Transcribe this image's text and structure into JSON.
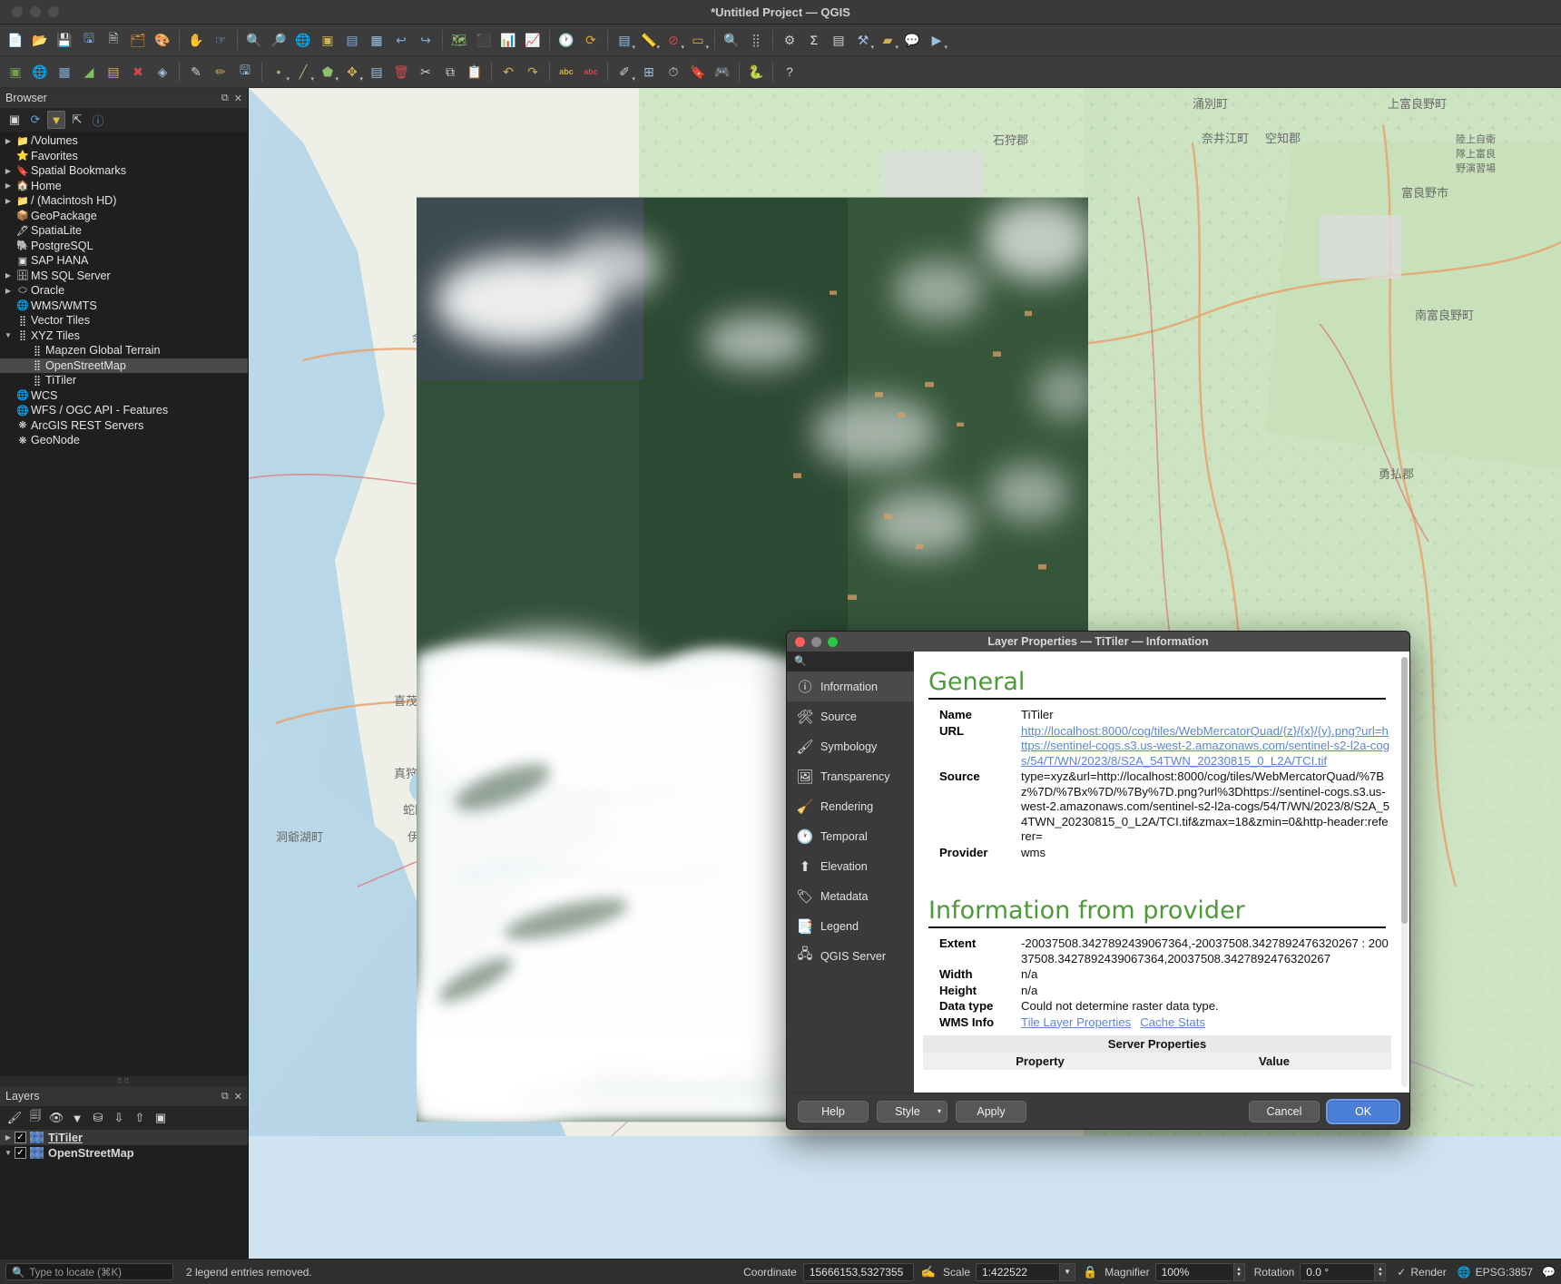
{
  "window": {
    "title": "*Untitled Project — QGIS"
  },
  "toolbar_rows": [
    [
      {
        "name": "new-project",
        "glyph": "📄",
        "color": "#e8e8e8"
      },
      {
        "name": "open-project",
        "glyph": "📂",
        "color": "#e0b152"
      },
      {
        "name": "save-project",
        "glyph": "💾",
        "color": "#7fa9d8"
      },
      {
        "name": "save-project-as",
        "glyph": "🖫",
        "color": "#7fa9d8"
      },
      {
        "name": "new-print-layout",
        "glyph": "🗎",
        "color": "#cfcfcf"
      },
      {
        "name": "layout-manager",
        "glyph": "🗂",
        "color": "#d08c3a"
      },
      {
        "name": "style-manager",
        "glyph": "🎨",
        "color": "#d04b4b"
      },
      {
        "sep": true
      },
      {
        "name": "pan-map",
        "glyph": "✋",
        "color": "#e8e8e8"
      },
      {
        "name": "pan-to-selection",
        "glyph": "☞",
        "color": "#7fa9d8"
      },
      {
        "sep": true
      },
      {
        "name": "zoom-in",
        "glyph": "🔍",
        "color": "#7fa9d8"
      },
      {
        "name": "zoom-out",
        "glyph": "🔎",
        "color": "#7fa9d8"
      },
      {
        "name": "zoom-full",
        "glyph": "🌐",
        "color": "#8fbf6f"
      },
      {
        "name": "zoom-to-selection",
        "glyph": "▣",
        "color": "#d0b050"
      },
      {
        "name": "zoom-to-layer",
        "glyph": "▤",
        "color": "#7fa9d8"
      },
      {
        "name": "zoom-to-native",
        "glyph": "▦",
        "color": "#9ac0e0"
      },
      {
        "name": "zoom-last",
        "glyph": "↩",
        "color": "#7fa9d8"
      },
      {
        "name": "zoom-next",
        "glyph": "↪",
        "color": "#7fa9d8"
      },
      {
        "sep": true
      },
      {
        "name": "new-map-view",
        "glyph": "🗺",
        "color": "#8fbf6f"
      },
      {
        "name": "new-3d-map-view",
        "glyph": "⬛",
        "color": "#9ac0e0"
      },
      {
        "name": "show-map-tips",
        "glyph": "📊",
        "color": "#d0b050"
      },
      {
        "name": "statistical-summary",
        "glyph": "📈",
        "color": "#cfcfcf"
      },
      {
        "sep": true
      },
      {
        "name": "identify-features",
        "glyph": "🕐",
        "color": "#e8e8e8"
      },
      {
        "name": "refresh",
        "glyph": "⟳",
        "color": "#e0a040"
      },
      {
        "sep": true
      },
      {
        "name": "open-attribute-table",
        "glyph": "▤",
        "color": "#9ac0e0",
        "caret": true
      },
      {
        "name": "measure-line",
        "glyph": "📏",
        "color": "#cfcfcf",
        "caret": true
      },
      {
        "name": "deselect-features",
        "glyph": "⊘",
        "color": "#d04b4b",
        "caret": true
      },
      {
        "name": "select-features",
        "glyph": "▭",
        "color": "#d0b050",
        "caret": true
      },
      {
        "sep": true
      },
      {
        "name": "select-by-expression",
        "glyph": "🔍",
        "color": "#e0e0e0"
      },
      {
        "name": "select-by-location",
        "glyph": "⣿",
        "color": "#9a9a9a"
      },
      {
        "sep": true
      },
      {
        "name": "options",
        "glyph": "⚙",
        "color": "#c8c8c8"
      },
      {
        "name": "field-calculator",
        "glyph": "Σ",
        "color": "#e8e8e8"
      },
      {
        "name": "show-layout-manager",
        "glyph": "▤",
        "color": "#cfcfcf"
      },
      {
        "name": "processing-toolbox",
        "glyph": "⚒",
        "color": "#9ac0e0",
        "caret": true
      },
      {
        "name": "measure-area",
        "glyph": "▰",
        "color": "#d0b050",
        "caret": true
      },
      {
        "name": "map-tips",
        "glyph": "💬",
        "color": "#e0d050"
      },
      {
        "name": "python-console-run",
        "glyph": "▶",
        "color": "#9ac0e0",
        "caret": true
      }
    ],
    [
      {
        "name": "new-shapefile-layer",
        "glyph": "▣",
        "color": "#6f9f4f"
      },
      {
        "name": "add-vector-layer",
        "glyph": "🌐",
        "color": "#c07a3a"
      },
      {
        "name": "add-raster-layer",
        "glyph": "▦",
        "color": "#7fa9d8"
      },
      {
        "name": "add-mesh-layer",
        "glyph": "◢",
        "color": "#7fbf5f"
      },
      {
        "name": "add-delimited-text-layer",
        "glyph": "▤",
        "color": "#d0b050"
      },
      {
        "name": "add-postgis-layer",
        "glyph": "✖",
        "color": "#d04b4b"
      },
      {
        "name": "add-spatialite-layer",
        "glyph": "◈",
        "color": "#9ac0e0"
      },
      {
        "sep": true
      },
      {
        "name": "digitize-toggle",
        "glyph": "✎",
        "color": "#cfcfcf"
      },
      {
        "name": "current-edits",
        "glyph": "✏",
        "color": "#d0a050"
      },
      {
        "name": "save-layer-edits",
        "glyph": "🖫",
        "color": "#9ac0e0"
      },
      {
        "sep": true
      },
      {
        "name": "add-feature-point",
        "glyph": "•",
        "color": "#8fbf6f",
        "caret": true
      },
      {
        "name": "add-feature-line",
        "glyph": "╱",
        "color": "#8fbf6f",
        "caret": true
      },
      {
        "name": "add-feature-polygon",
        "glyph": "⬟",
        "color": "#8fbf6f",
        "caret": true
      },
      {
        "name": "vertex-tool",
        "glyph": "✥",
        "color": "#d0b050",
        "caret": true
      },
      {
        "name": "modify-attributes",
        "glyph": "▤",
        "color": "#9ac0e0"
      },
      {
        "name": "delete-selected",
        "glyph": "🗑",
        "color": "#d04b4b"
      },
      {
        "name": "cut-features",
        "glyph": "✂",
        "color": "#cfcfcf"
      },
      {
        "name": "copy-features",
        "glyph": "⧉",
        "color": "#cfcfcf"
      },
      {
        "name": "paste-features",
        "glyph": "📋",
        "color": "#cfcfcf"
      },
      {
        "sep": true
      },
      {
        "name": "undo",
        "glyph": "↶",
        "color": "#d0b050"
      },
      {
        "name": "redo",
        "glyph": "↷",
        "color": "#d0b050"
      },
      {
        "sep": true
      },
      {
        "name": "label-toggle",
        "glyph": "abc",
        "color": "#d0b050",
        "small": true
      },
      {
        "name": "label-highlight",
        "glyph": "abc",
        "color": "#d04b4b",
        "small": true
      },
      {
        "sep": true
      },
      {
        "name": "annotations",
        "glyph": "✐",
        "color": "#cfcfcf",
        "caret": true
      },
      {
        "name": "georeferencer",
        "glyph": "⊞",
        "color": "#9ac0e0"
      },
      {
        "name": "temporal-controller",
        "glyph": "⏱",
        "color": "#cfcfcf"
      },
      {
        "name": "show-bookmarks",
        "glyph": "🔖",
        "color": "#9ac0e0"
      },
      {
        "name": "new-3d-view",
        "glyph": "🎮",
        "color": "#8aa8c8"
      },
      {
        "sep": true
      },
      {
        "name": "python-console",
        "glyph": "🐍",
        "color": "#5a9fd8"
      },
      {
        "sep": true
      },
      {
        "name": "help-contents",
        "glyph": "?",
        "color": "#cfcfcf"
      }
    ]
  ],
  "browser": {
    "title": "Browser",
    "tools": [
      {
        "name": "add-layers-icon",
        "glyph": "▣"
      },
      {
        "name": "refresh-icon",
        "glyph": "⟳"
      },
      {
        "name": "filter-browser-icon",
        "glyph": "▼",
        "active": true
      },
      {
        "name": "collapse-all-icon",
        "glyph": "⇱"
      },
      {
        "name": "enable-properties-widget-icon",
        "glyph": "ⓘ"
      }
    ],
    "items": [
      {
        "label": "/Volumes",
        "arrow": "▶",
        "icon": "📁",
        "indent": 0
      },
      {
        "label": "Favorites",
        "arrow": "",
        "icon": "⭐",
        "indent": 0
      },
      {
        "label": "Spatial Bookmarks",
        "arrow": "▶",
        "icon": "🔖",
        "indent": 0
      },
      {
        "label": "Home",
        "arrow": "▶",
        "icon": "🏠",
        "indent": 0
      },
      {
        "label": "/ (Macintosh HD)",
        "arrow": "▶",
        "icon": "📁",
        "indent": 0
      },
      {
        "label": "GeoPackage",
        "arrow": "",
        "icon": "📦",
        "indent": 0
      },
      {
        "label": "SpatiaLite",
        "arrow": "",
        "icon": "🖋",
        "indent": 0
      },
      {
        "label": "PostgreSQL",
        "arrow": "",
        "icon": "🐘",
        "indent": 0
      },
      {
        "label": "SAP HANA",
        "arrow": "",
        "icon": "▣",
        "indent": 0
      },
      {
        "label": "MS SQL Server",
        "arrow": "▶",
        "icon": "🗄",
        "indent": 0
      },
      {
        "label": "Oracle",
        "arrow": "▶",
        "icon": "⬭",
        "indent": 0
      },
      {
        "label": "WMS/WMTS",
        "arrow": "",
        "icon": "🌐",
        "indent": 0
      },
      {
        "label": "Vector Tiles",
        "arrow": "",
        "icon": "⣿",
        "indent": 0
      },
      {
        "label": "XYZ Tiles",
        "arrow": "▼",
        "icon": "⣿",
        "indent": 0
      },
      {
        "label": "Mapzen Global Terrain",
        "arrow": "",
        "icon": "⣿",
        "indent": 1
      },
      {
        "label": "OpenStreetMap",
        "arrow": "",
        "icon": "⣿",
        "indent": 1,
        "selected": true
      },
      {
        "label": "TiTiler",
        "arrow": "",
        "icon": "⣿",
        "indent": 1
      },
      {
        "label": "WCS",
        "arrow": "",
        "icon": "🌐",
        "indent": 0
      },
      {
        "label": "WFS / OGC API - Features",
        "arrow": "",
        "icon": "🌐",
        "indent": 0
      },
      {
        "label": "ArcGIS REST Servers",
        "arrow": "",
        "icon": "❋",
        "indent": 0
      },
      {
        "label": "GeoNode",
        "arrow": "",
        "icon": "❋",
        "indent": 0
      }
    ]
  },
  "layers": {
    "title": "Layers",
    "tools": [
      {
        "name": "open-layer-styling-panel-icon",
        "glyph": "🖌"
      },
      {
        "name": "add-group-icon",
        "glyph": "🗐"
      },
      {
        "name": "manage-map-themes-icon",
        "glyph": "👁"
      },
      {
        "name": "filter-legend-icon",
        "glyph": "▼"
      },
      {
        "name": "filter-legend-by-expression-icon",
        "glyph": "⛁"
      },
      {
        "name": "expand-all-icon",
        "glyph": "⇩"
      },
      {
        "name": "collapse-all-icon",
        "glyph": "⇧"
      },
      {
        "name": "remove-layer-icon",
        "glyph": "▣"
      }
    ],
    "items": [
      {
        "label": "TiTiler",
        "checked": true,
        "arrow": "▶",
        "selected": true
      },
      {
        "label": "OpenStreetMap",
        "checked": true,
        "arrow": "▼",
        "selected": false
      }
    ]
  },
  "status": {
    "locate_placeholder": "Type to locate (⌘K)",
    "message": "2 legend entries removed.",
    "coordinate_label": "Coordinate",
    "coordinate_value": "15666153,5327355",
    "scale_label": "Scale",
    "scale_value": "1:422522",
    "magnifier_label": "Magnifier",
    "magnifier_value": "100%",
    "rotation_label": "Rotation",
    "rotation_value": "0.0 °",
    "render_label": "Render",
    "render_checked": true,
    "crs_value": "EPSG:3857"
  },
  "dialog": {
    "title": "Layer Properties — TiTiler — Information",
    "search_placeholder": "",
    "sidebar": [
      {
        "label": "Information",
        "icon": "ⓘ",
        "name": "information",
        "active": true
      },
      {
        "label": "Source",
        "icon": "🛠",
        "name": "source",
        "active": false
      },
      {
        "label": "Symbology",
        "icon": "🖌",
        "name": "symbology",
        "active": false
      },
      {
        "label": "Transparency",
        "icon": "🖼",
        "name": "transparency",
        "active": false
      },
      {
        "label": "Rendering",
        "icon": "🧹",
        "name": "rendering",
        "active": false
      },
      {
        "label": "Temporal",
        "icon": "🕐",
        "name": "temporal",
        "active": false
      },
      {
        "label": "Elevation",
        "icon": "⬆",
        "name": "elevation",
        "active": false
      },
      {
        "label": "Metadata",
        "icon": "🏷",
        "name": "metadata",
        "active": false
      },
      {
        "label": "Legend",
        "icon": "📑",
        "name": "legend",
        "active": false
      },
      {
        "label": "QGIS Server",
        "icon": "🖧",
        "name": "qgis-server",
        "active": false
      }
    ],
    "general": {
      "heading": "General",
      "name_label": "Name",
      "name_value": "TiTiler",
      "url_label": "URL",
      "url_value": "http://localhost:8000/cog/tiles/WebMercatorQuad/{z}/{x}/{y}.png?url=https://sentinel-cogs.s3.us-west-2.amazonaws.com/sentinel-s2-l2a-cogs/54/T/WN/2023/8/S2A_54TWN_20230815_0_L2A/TCI.tif",
      "source_label": "Source",
      "source_value": "type=xyz&url=http://localhost:8000/cog/tiles/WebMercatorQuad/%7Bz%7D/%7Bx%7D/%7By%7D.png?url%3Dhttps://sentinel-cogs.s3.us-west-2.amazonaws.com/sentinel-s2-l2a-cogs/54/T/WN/2023/8/S2A_54TWN_20230815_0_L2A/TCI.tif&zmax=18&zmin=0&http-header:referer=",
      "provider_label": "Provider",
      "provider_value": "wms"
    },
    "provider_info": {
      "heading": "Information from provider",
      "extent_label": "Extent",
      "extent_value": "-20037508.3427892439067364,-20037508.3427892476320267 : 20037508.3427892439067364,20037508.3427892476320267",
      "width_label": "Width",
      "width_value": "n/a",
      "height_label": "Height",
      "height_value": "n/a",
      "datatype_label": "Data type",
      "datatype_value": "Could not determine raster data type.",
      "wmsinfo_label": "WMS Info",
      "wmsinfo_links": [
        "Tile Layer Properties",
        "Cache Stats"
      ],
      "server_properties_heading": "Server Properties",
      "server_cols": [
        "Property",
        "Value"
      ]
    },
    "buttons": {
      "help": "Help",
      "style": "Style",
      "apply": "Apply",
      "cancel": "Cancel",
      "ok": "OK"
    }
  },
  "colors": {
    "accent_green": "#4e9a38",
    "link_blue": "#5b87d0",
    "primary_button": "#4c7fd6"
  }
}
